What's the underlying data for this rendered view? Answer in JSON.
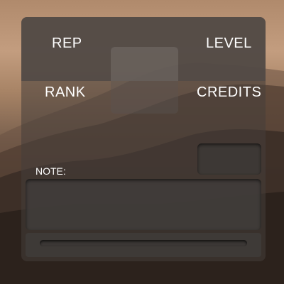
{
  "profile_card": {
    "rep_label": "REP",
    "level_label": "LEVEL",
    "rank_label": "RANK",
    "credits_label": "CREDITS",
    "note_label": "NOTE:",
    "note_value": "",
    "progress": 0
  }
}
